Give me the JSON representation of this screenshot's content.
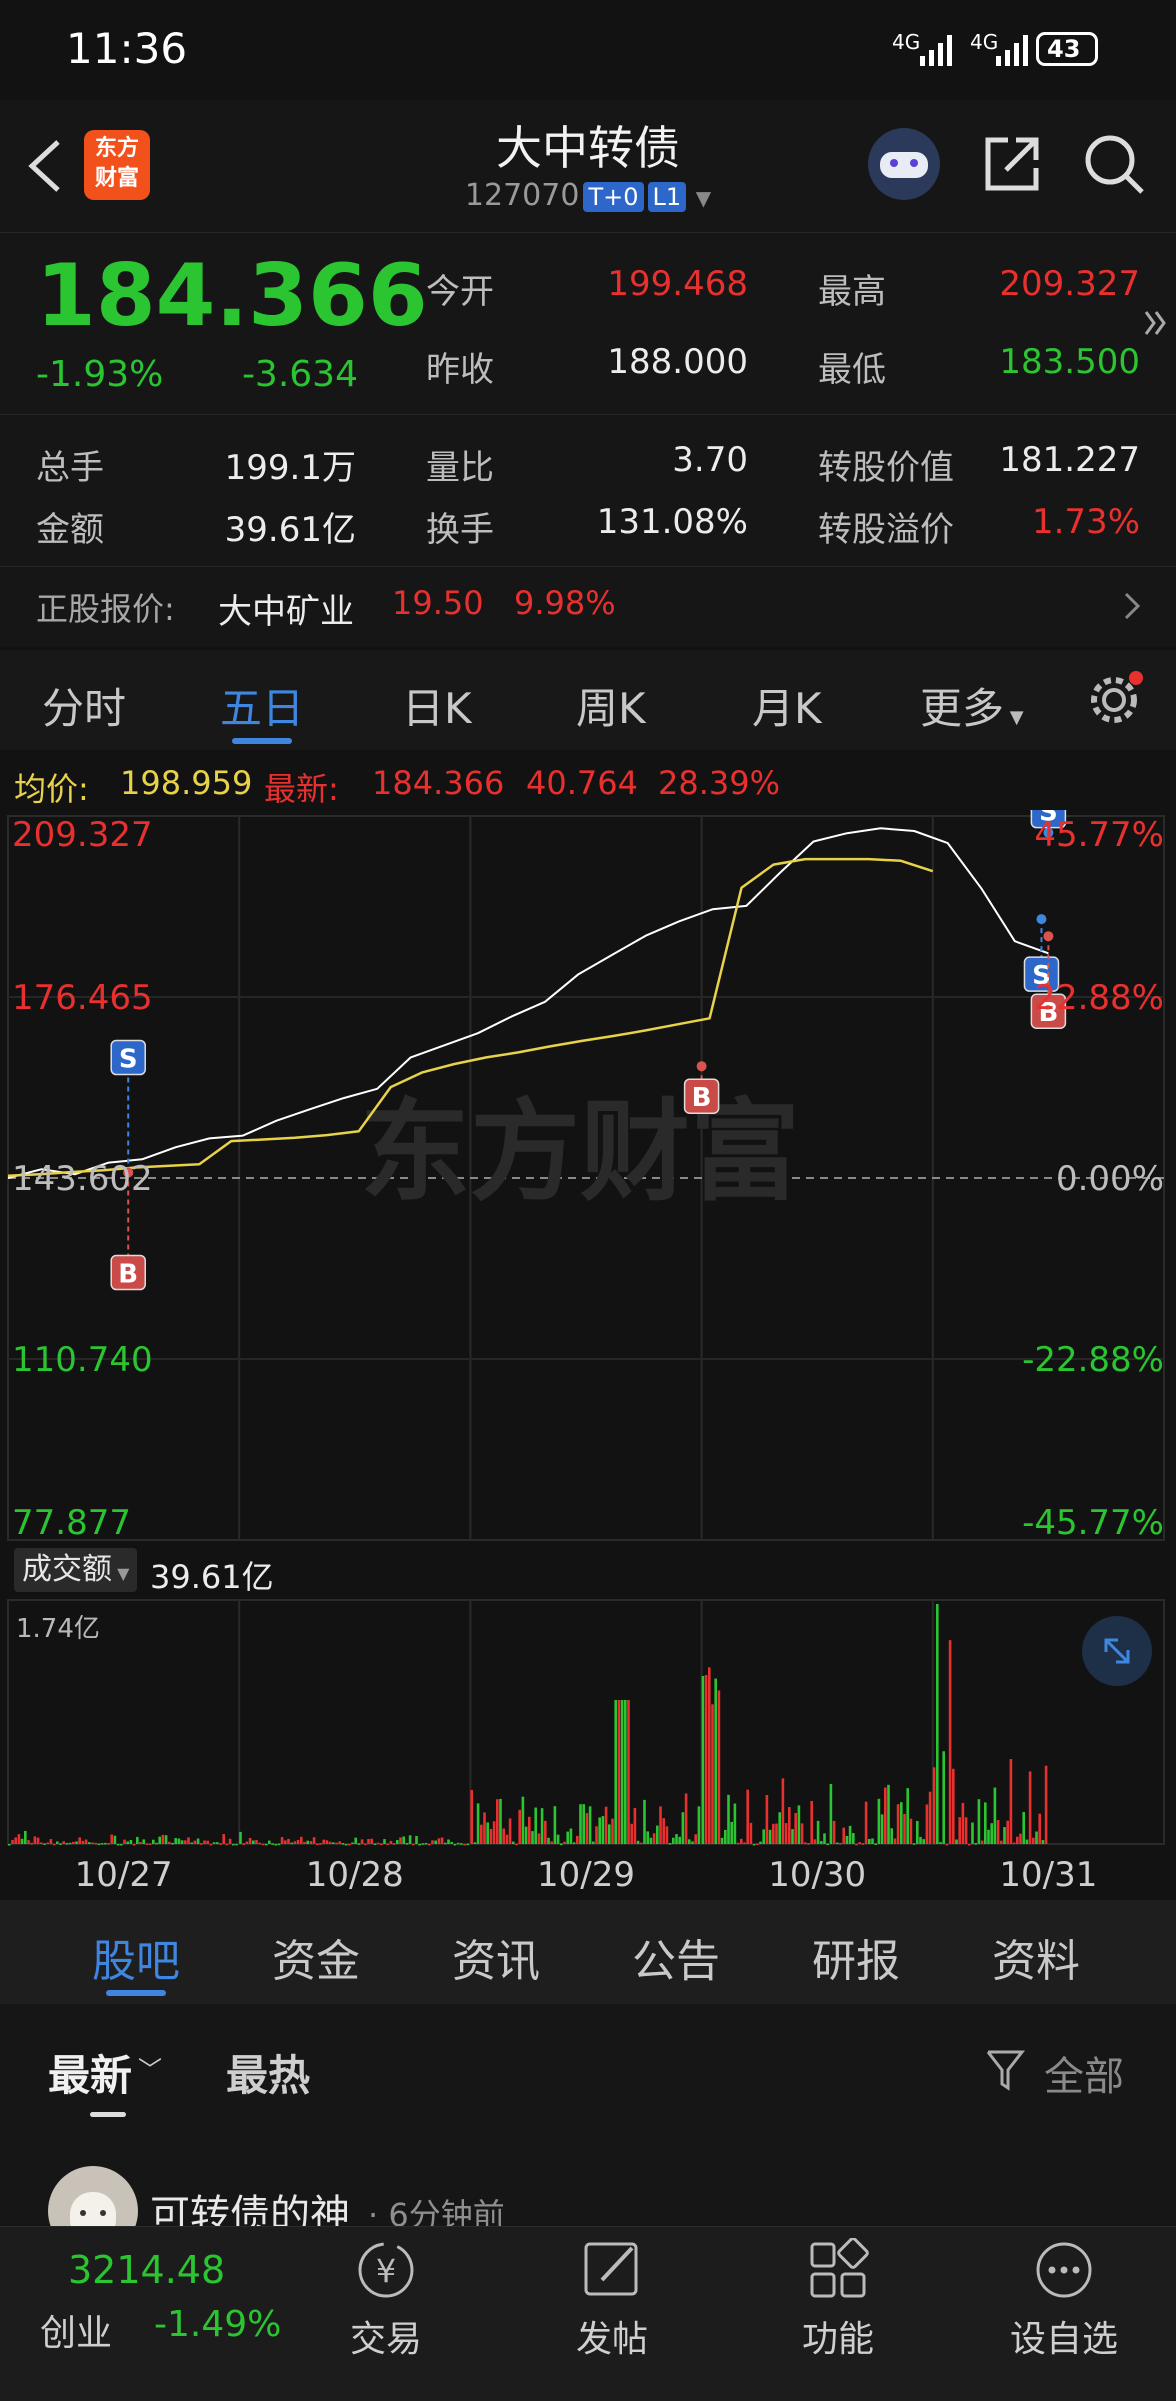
{
  "status_bar": {
    "time": "11:36",
    "signal1": "4G",
    "signal2": "4G",
    "battery": "43"
  },
  "header": {
    "back_icon": "chevron-left-icon",
    "logo_text": "东方财富",
    "title": "大中转债",
    "code": "127070",
    "tag1": "T+0",
    "tag2": "L1",
    "icons": [
      "robot-avatar-icon",
      "share-icon",
      "search-icon"
    ]
  },
  "quote": {
    "price": "184.366",
    "change_pct": "-1.93%",
    "change": "-3.634",
    "open_label": "今开",
    "open": "199.468",
    "high_label": "最高",
    "high": "209.327",
    "prev_close_label": "昨收",
    "prev_close": "188.000",
    "low_label": "最低",
    "low": "183.500",
    "volume_label": "总手",
    "volume": "199.1万",
    "vol_ratio_label": "量比",
    "vol_ratio": "3.70",
    "conv_value_label": "转股价值",
    "conv_value": "181.227",
    "amount_label": "金额",
    "amount": "39.61亿",
    "turnover_label": "换手",
    "turnover": "131.08%",
    "premium_label": "转股溢价",
    "premium": "1.73%",
    "stock_label": "正股报价:",
    "stock_name": "大中矿业",
    "stock_price": "19.50",
    "stock_pct": "9.98%"
  },
  "tabs": {
    "t1": "分时",
    "t2": "五日",
    "t3": "日K",
    "t4": "周K",
    "t5": "月K",
    "t6": "更多"
  },
  "info_bar": {
    "avg_label": "均价:",
    "avg": "198.959",
    "latest_label": "最新:",
    "latest": "184.366",
    "diff": "40.764",
    "pct": "28.39%"
  },
  "chart_data": {
    "type": "line",
    "title": "",
    "y_left_ticks": [
      "209.327",
      "176.465",
      "143.602",
      "110.740",
      "77.877"
    ],
    "y_right_ticks": [
      "45.77%",
      "22.88%",
      "0.00%",
      "-22.88%",
      "-45.77%"
    ],
    "x": [
      "10/27",
      "10/28",
      "10/29",
      "10/30",
      "10/31"
    ],
    "ylim": [
      77.877,
      209.327
    ],
    "baseline": 143.602,
    "series": [
      {
        "color": "#ffffff",
        "values": [
          143.6,
          145.2,
          144.3,
          146.4,
          147.0,
          149.2,
          150.8,
          151.3,
          154.0,
          156.1,
          158.1,
          159.8,
          165.5,
          167.7,
          169.9,
          172.9,
          175.6,
          180.6,
          184.1,
          187.6,
          190.2,
          192.4,
          193.0,
          199.0,
          204.7,
          206.2,
          207.1,
          206.6,
          204.4,
          196.2,
          186.6,
          184.4
        ]
      },
      {
        "color": "#e8d24a",
        "values": [
          144.0,
          144.3,
          144.7,
          145.0,
          145.5,
          145.8,
          146.1,
          150.3,
          150.6,
          150.9,
          151.4,
          152.1,
          160.1,
          162.8,
          164.3,
          165.5,
          166.4,
          167.5,
          168.5,
          169.4,
          170.4,
          171.5,
          172.6,
          196.3,
          200.5,
          201.5,
          201.5,
          201.5,
          201.2,
          199.3
        ]
      }
    ],
    "markers": [
      {
        "type": "S",
        "day": 0,
        "value": 144.6
      },
      {
        "type": "B",
        "day": 0,
        "value": 144.6
      },
      {
        "type": "B",
        "day": 2,
        "value": 163.9
      },
      {
        "type": "S",
        "day": 4,
        "value": 206.3
      },
      {
        "type": "S",
        "day": 4,
        "value": 190.6
      },
      {
        "type": "B",
        "day": 4,
        "value": 187.5
      }
    ],
    "watermark": "东方财富",
    "volume_label": "成交额",
    "volume_total": "39.61亿",
    "volume_max_label": "1.74亿",
    "volume_axis_max": 1.74,
    "volume_seed": 7
  },
  "section_tabs": [
    "股吧",
    "资金",
    "资讯",
    "公告",
    "研报",
    "资料"
  ],
  "feed": {
    "sort_latest": "最新",
    "sort_hot": "最热",
    "filter": "全部",
    "user": "可转债的神",
    "time": "· 6分钟前"
  },
  "tabbar": {
    "index_value": "3214.48",
    "index_name": "创业",
    "index_pct": "-1.49%",
    "items": [
      "交易",
      "发帖",
      "功能",
      "设自选"
    ],
    "icons": [
      "yen-icon",
      "edit-icon",
      "grid-icon",
      "more-icon"
    ]
  },
  "colors": {
    "up": "#e8312f",
    "down": "#2bc531",
    "accent": "#3f86e0"
  }
}
